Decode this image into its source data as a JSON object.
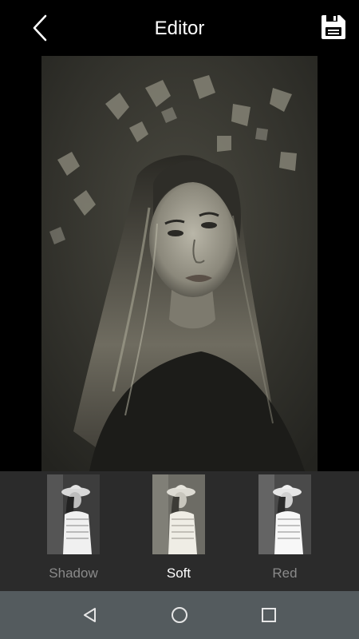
{
  "header": {
    "title": "Editor",
    "back_icon": "chevron-left-icon",
    "save_icon": "save-disk-icon"
  },
  "filters": [
    {
      "label": "Shadow",
      "selected": false
    },
    {
      "label": "Soft",
      "selected": true
    },
    {
      "label": "Red",
      "selected": false
    }
  ],
  "navbar": {
    "back_icon": "nav-back-icon",
    "home_icon": "nav-home-icon",
    "recents_icon": "nav-recents-icon"
  },
  "colors": {
    "background": "#000000",
    "filter_strip": "#2b2b2b",
    "navbar": "#545b5e",
    "label_selected": "#ffffff",
    "label_unselected": "#8a8a8a"
  }
}
